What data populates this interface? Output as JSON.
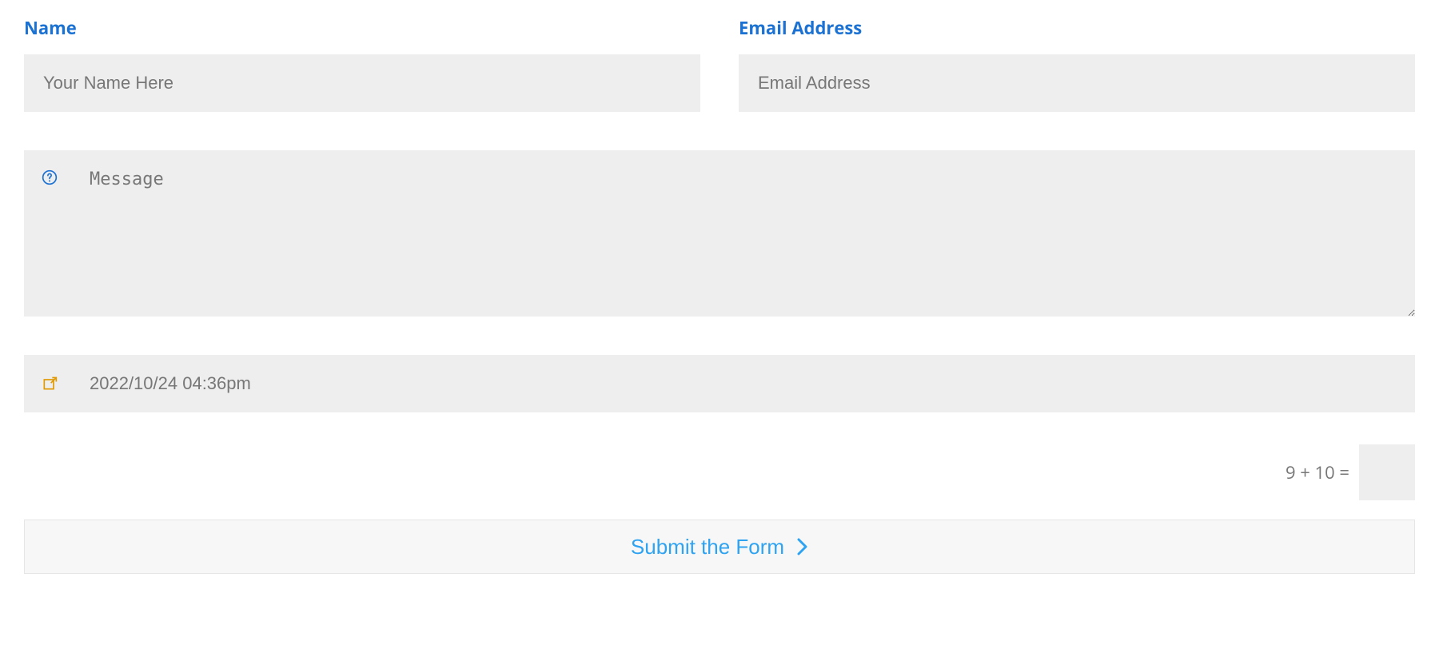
{
  "form": {
    "name": {
      "label": "Name",
      "placeholder": "Your Name Here",
      "value": ""
    },
    "email": {
      "label": "Email Address",
      "placeholder": "Email Address",
      "value": ""
    },
    "message": {
      "placeholder": "Message",
      "value": ""
    },
    "datetime": {
      "value": "2022/10/24 04:36pm"
    },
    "captcha": {
      "question": "9 + 10 =",
      "value": ""
    },
    "submit": {
      "label": "Submit the Form"
    }
  }
}
